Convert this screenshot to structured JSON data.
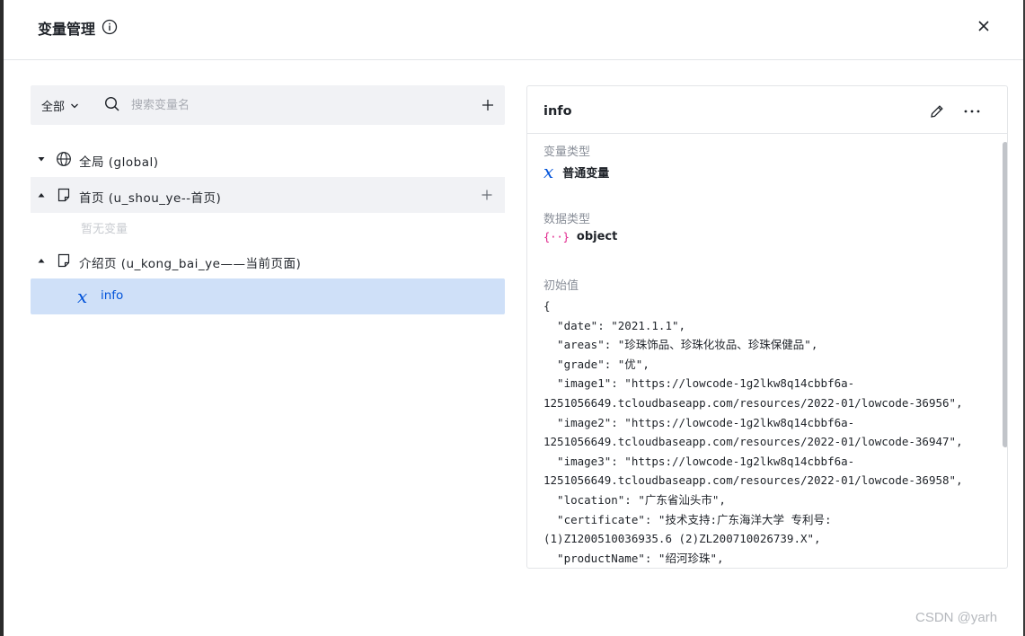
{
  "dialog": {
    "title": "变量管理",
    "close_icon": "close-icon"
  },
  "toolbar": {
    "scope_value": "全部",
    "search_placeholder": "搜索变量名"
  },
  "tree": {
    "global_label": "全局 (global)",
    "home_label": "首页 (u_shou_ye--首页)",
    "home_empty": "暂无变量",
    "intro_label": "介绍页 (u_kong_bai_ye——当前页面)",
    "selected_var": "info"
  },
  "detail": {
    "title": "info",
    "var_type_label": "变量类型",
    "var_type_value": "普通变量",
    "data_type_label": "数据类型",
    "data_type_value": "object",
    "initial_label": "初始值",
    "initial_lines": [
      "{",
      "  \"date\": \"2021.1.1\",",
      "  \"areas\": \"珍珠饰品、珍珠化妆品、珍珠保健品\",",
      "  \"grade\": \"优\",",
      "  \"image1\": \"https://lowcode-1g2lkw8q14cbbf6a-",
      "1251056649.tcloudbaseapp.com/resources/2022-01/lowcode-36956\",",
      "  \"image2\": \"https://lowcode-1g2lkw8q14cbbf6a-",
      "1251056649.tcloudbaseapp.com/resources/2022-01/lowcode-36947\",",
      "  \"image3\": \"https://lowcode-1g2lkw8q14cbbf6a-",
      "1251056649.tcloudbaseapp.com/resources/2022-01/lowcode-36958\",",
      "  \"location\": \"广东省汕头市\",",
      "  \"certificate\": \"技术支持:广东海洋大学 专利号:",
      "(1)Z1200510036935.6 (2)ZL200710026739.X\",",
      "  \"productName\": \"绍河珍珠\","
    ]
  },
  "watermark": "CSDN @yarh",
  "colors": {
    "accent": "#0052d9",
    "selected_bg": "#cfe0f8",
    "toolbar_bg": "#f1f2f5",
    "object_icon": "#e0218a"
  }
}
